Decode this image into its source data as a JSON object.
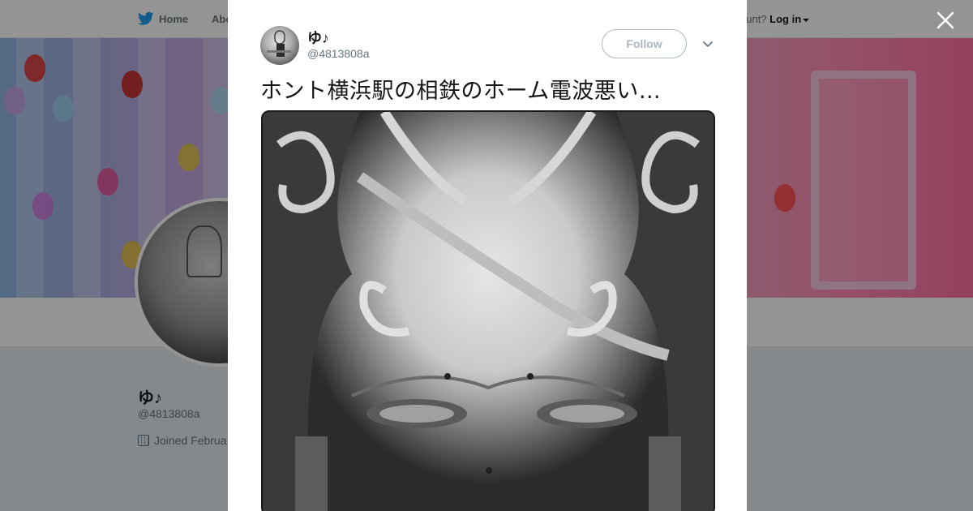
{
  "nav": {
    "home_label": "Home",
    "about_label": "Abo",
    "have_account_label": "ccount?",
    "login_label": "Log in"
  },
  "profile": {
    "name": "ゆ♪",
    "handle": "@4813808a",
    "joined": "Joined Februa"
  },
  "modal": {
    "author_name": "ゆ♪",
    "author_handle": "@4813808a",
    "follow_label": "Follow",
    "tweet_text": "ホント横浜駅の相鉄のホーム電波悪い…"
  },
  "colors": {
    "twitter_blue": "#1da1f2",
    "overlay": "rgba(0,0,0,0.42)",
    "muted_text": "#657786"
  },
  "icons": [
    "twitter-bird-icon",
    "caret-down-icon",
    "close-icon",
    "chevron-down-icon",
    "calendar-icon"
  ]
}
